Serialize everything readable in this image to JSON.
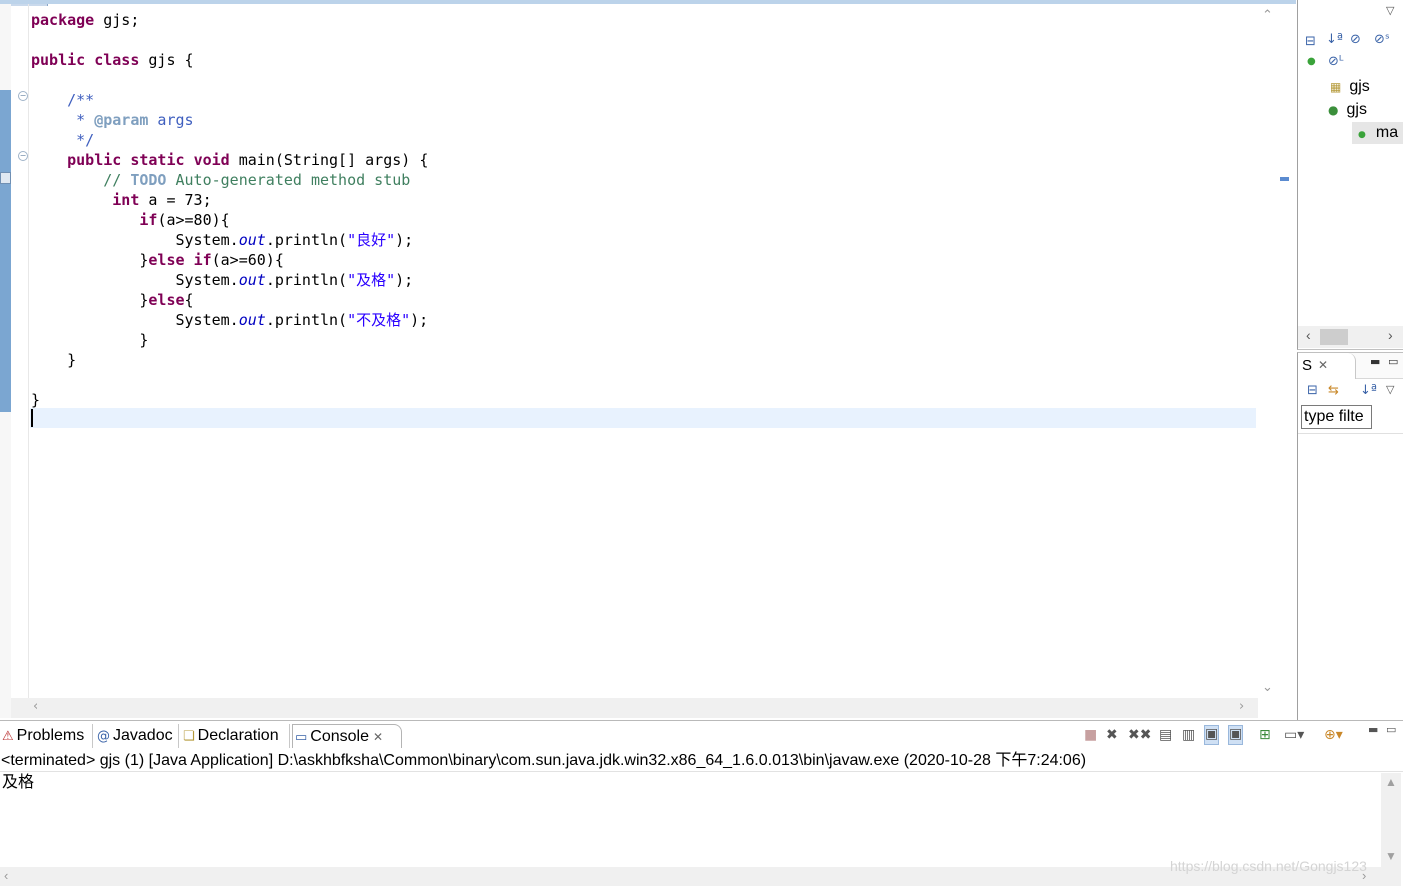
{
  "editor": {
    "lines": [
      [
        {
          "t": "package",
          "c": "kw"
        },
        {
          "t": " gjs;"
        }
      ],
      [],
      [
        {
          "t": "public",
          "c": "kw"
        },
        {
          "t": " "
        },
        {
          "t": "class",
          "c": "kw"
        },
        {
          "t": " gjs {"
        }
      ],
      [],
      [
        {
          "t": "    /**",
          "c": "jdoc"
        }
      ],
      [
        {
          "t": "     * ",
          "c": "jdoc"
        },
        {
          "t": "@param",
          "c": "jtag"
        },
        {
          "t": " args",
          "c": "jdoc"
        }
      ],
      [
        {
          "t": "     */",
          "c": "jdoc"
        }
      ],
      [
        {
          "t": "    "
        },
        {
          "t": "public",
          "c": "kw"
        },
        {
          "t": " "
        },
        {
          "t": "static",
          "c": "kw"
        },
        {
          "t": " "
        },
        {
          "t": "void",
          "c": "kw"
        },
        {
          "t": " main(String[] args) {"
        }
      ],
      [
        {
          "t": "        // ",
          "c": "cmt"
        },
        {
          "t": "TODO",
          "c": "todo"
        },
        {
          "t": " Auto-generated method stub",
          "c": "cmt"
        }
      ],
      [
        {
          "t": "         "
        },
        {
          "t": "int",
          "c": "kw"
        },
        {
          "t": " a = 73;"
        }
      ],
      [
        {
          "t": "            "
        },
        {
          "t": "if",
          "c": "kw"
        },
        {
          "t": "(a>=80){"
        }
      ],
      [
        {
          "t": "                System."
        },
        {
          "t": "out",
          "c": "fld"
        },
        {
          "t": ".println("
        },
        {
          "t": "\"良好\"",
          "c": "str"
        },
        {
          "t": ");"
        }
      ],
      [
        {
          "t": "            }"
        },
        {
          "t": "else",
          "c": "kw"
        },
        {
          "t": " "
        },
        {
          "t": "if",
          "c": "kw"
        },
        {
          "t": "(a>=60){"
        }
      ],
      [
        {
          "t": "                System."
        },
        {
          "t": "out",
          "c": "fld"
        },
        {
          "t": ".println("
        },
        {
          "t": "\"及格\"",
          "c": "str"
        },
        {
          "t": ");"
        }
      ],
      [
        {
          "t": "            }"
        },
        {
          "t": "else",
          "c": "kw"
        },
        {
          "t": "{"
        }
      ],
      [
        {
          "t": "                System."
        },
        {
          "t": "out",
          "c": "fld"
        },
        {
          "t": ".println("
        },
        {
          "t": "\"不及格\"",
          "c": "str"
        },
        {
          "t": ");"
        }
      ],
      [
        {
          "t": "            }"
        }
      ],
      [
        {
          "t": "    }"
        }
      ],
      [],
      [
        {
          "t": "}"
        }
      ],
      []
    ]
  },
  "outline": {
    "items": [
      {
        "icon": "package-icon",
        "glyph": "▦",
        "color": "#b59a3a",
        "label": "gjs"
      },
      {
        "icon": "class-icon",
        "glyph": "●",
        "color": "#3b8f3b",
        "label": "gjs"
      },
      {
        "icon": "method-icon",
        "glyph": "●",
        "color": "#3aa33a",
        "label": "ma"
      }
    ]
  },
  "panel2": {
    "tab_label": "S",
    "filter_value": "type filte"
  },
  "console": {
    "tabs": [
      {
        "icon": "problems-icon",
        "glyph": "⚠",
        "label": "Problems"
      },
      {
        "icon": "javadoc-icon",
        "glyph": "@",
        "label": "Javadoc"
      },
      {
        "icon": "declaration-icon",
        "glyph": "❏",
        "label": "Declaration"
      },
      {
        "icon": "console-icon",
        "glyph": "▭",
        "label": "Console"
      }
    ],
    "description": "<terminated> gjs (1) [Java Application] D:\\askhbfksha\\Common\\binary\\com.sun.java.jdk.win32.x86_64_1.6.0.013\\bin\\javaw.exe (2020-10-28 下午7:24:06)",
    "output": "及格",
    "watermark": "https://blog.csdn.net/Gongjs123"
  }
}
